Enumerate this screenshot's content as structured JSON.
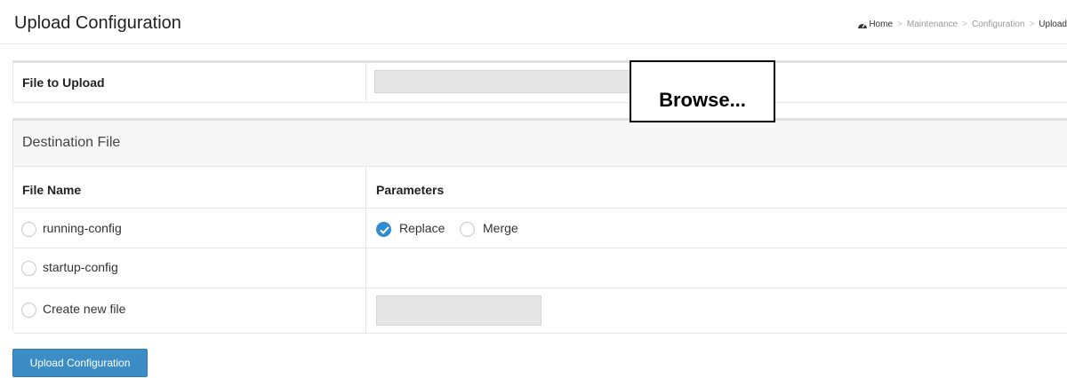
{
  "header": {
    "title": "Upload Configuration",
    "breadcrumb": {
      "home": "Home",
      "items": [
        "Maintenance",
        "Configuration"
      ],
      "current": "Upload"
    }
  },
  "upload": {
    "label": "File to Upload",
    "file_path_value": "",
    "browse_label": "Browse..."
  },
  "destination": {
    "title": "Destination File",
    "headers": {
      "file_name": "File Name",
      "parameters": "Parameters"
    },
    "options": [
      {
        "label": "running-config",
        "selected": false
      },
      {
        "label": "startup-config",
        "selected": false
      },
      {
        "label": "Create new file",
        "selected": false
      }
    ],
    "parameters": {
      "replace": "Replace",
      "replace_selected": true,
      "merge": "Merge",
      "merge_selected": false
    },
    "new_file_value": ""
  },
  "actions": {
    "upload_label": "Upload Configuration"
  },
  "colors": {
    "accent": "#3c8dc6",
    "radio_checked": "#2f8ccf",
    "input_bg": "#e6e6e6"
  }
}
